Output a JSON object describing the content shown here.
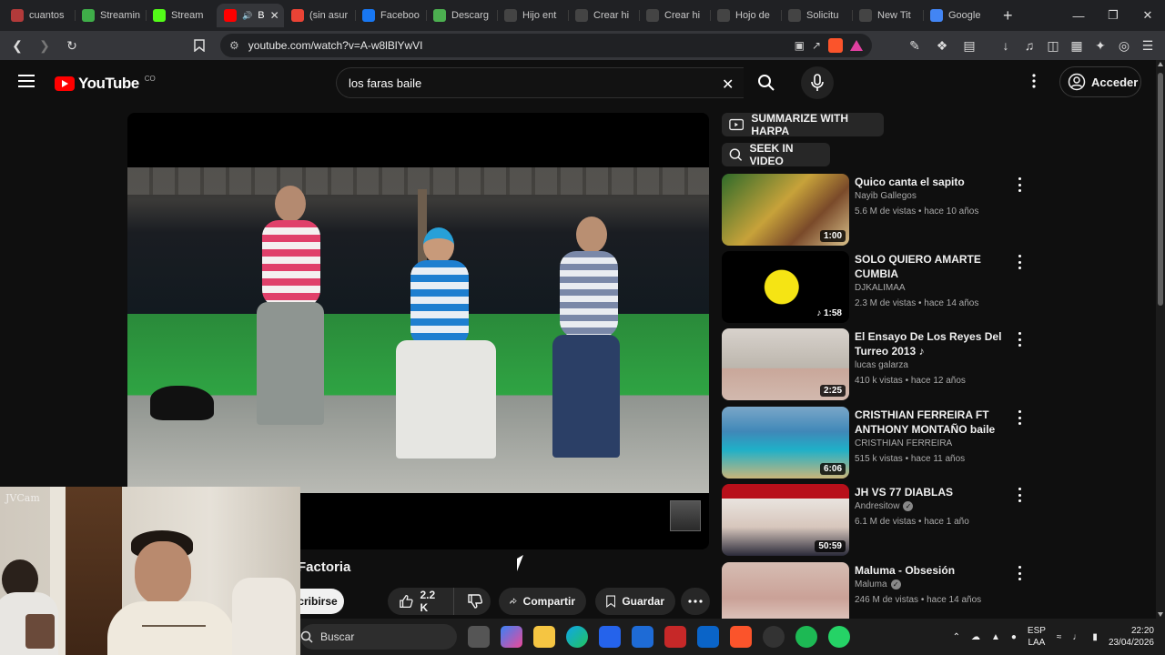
{
  "browser": {
    "tabs": [
      {
        "label": "cuantos",
        "icon": "chatgpt-icon",
        "color": "#b23a3a"
      },
      {
        "label": "Streamin",
        "icon": "stream-icon",
        "color": "#3fae49"
      },
      {
        "label": "Stream",
        "icon": "kick-icon",
        "color": "#53fc18"
      },
      {
        "label": "B",
        "icon": "youtube-icon",
        "color": "#ff0000",
        "active": true
      },
      {
        "label": "(sin asur",
        "icon": "gmail-icon",
        "color": "#ea4335"
      },
      {
        "label": "Faceboo",
        "icon": "facebook-icon",
        "color": "#1877f2"
      },
      {
        "label": "Descarg",
        "icon": "download-icon",
        "color": "#4caf50"
      },
      {
        "label": "Hijo ent",
        "icon": "openai-icon",
        "color": "#444444"
      },
      {
        "label": "Crear hi",
        "icon": "openai-icon",
        "color": "#444444"
      },
      {
        "label": "Crear hi",
        "icon": "openai-icon",
        "color": "#444444"
      },
      {
        "label": "Hojo de",
        "icon": "openai-icon",
        "color": "#444444"
      },
      {
        "label": "Solicitu",
        "icon": "openai-icon",
        "color": "#444444"
      },
      {
        "label": "New Tit",
        "icon": "openai-icon",
        "color": "#444444"
      },
      {
        "label": "Google",
        "icon": "gemini-icon",
        "color": "#4285f4"
      }
    ],
    "url": "youtube.com/watch?v=A-w8lBlYwVI"
  },
  "youtube": {
    "logo_text": "YouTube",
    "country_code": "CO",
    "search_query": "los faras baile",
    "signin_label": "Acceder",
    "video_title": "Factoria",
    "subscribe_label": "cribirse",
    "likes": "2.2 K",
    "share_label": "Compartir",
    "save_label": "Guardar",
    "chips": [
      "SUMMARIZE WITH HARPA",
      "SEEK IN VIDEO"
    ],
    "recommendations": [
      {
        "title": "Quico canta el sapito",
        "channel": "Nayib Gallegos",
        "meta": "5.6 M de vistas • hace 10 años",
        "duration": "1:00",
        "verified": false,
        "thumb": "linear-gradient(135deg,#2f6b2a,#c7a23a 45%,#7a4a2a 70%,#d8c08a)"
      },
      {
        "title": "SOLO QUIERO AMARTE CUMBIA",
        "channel": "DJKALIMAA",
        "meta": "2.3 M de vistas • hace 14 años",
        "duration": "♪ 1:58",
        "verified": false,
        "thumb": "radial-gradient(circle at 47% 50%,#f5e414 0 22%,#000 23%)"
      },
      {
        "title": "El Ensayo De Los Reyes Del Turreo 2013 ♪",
        "channel": "lucas galarza",
        "meta": "410 k vistas • hace 12 años",
        "duration": "2:25",
        "verified": false,
        "thumb": "linear-gradient(#d8d2cc,#bcb6ad 55%,#c9a79a 56%,#d2b9ae)"
      },
      {
        "title": "CRISTHIAN FERREIRA FT ANTHONY MONTAÑO baile en...",
        "channel": "CRISTHIAN FERREIRA",
        "meta": "515 k vistas • hace 11 años",
        "duration": "6:06",
        "verified": false,
        "thumb": "linear-gradient(#7aa6c8,#3f88b8 35%,#1fb0c8 60%,#c9b57a)"
      },
      {
        "title": "JH VS 77 DIABLAS",
        "channel": "Andresitow",
        "meta": "6.1 M de vistas • hace 1 año",
        "duration": "50:59",
        "verified": true,
        "thumb": "linear-gradient(#b80f1a 0 20%,#e9e4df 20%,#d7c6bc 60%,#2b2b3a)"
      },
      {
        "title": "Maluma - Obsesión",
        "channel": "Maluma",
        "meta": "246 M de vistas • hace 14 años",
        "duration": "",
        "verified": true,
        "thumb": "linear-gradient(#d6bdb3,#caa197 50%,#e9d9d2)"
      }
    ]
  },
  "webcam": {
    "watermark": "JVCam"
  },
  "taskbar": {
    "search_placeholder": "Buscar",
    "lang_top": "ESP",
    "lang_bottom": "LAA",
    "time": "22:20",
    "date": "23/04/2026"
  }
}
